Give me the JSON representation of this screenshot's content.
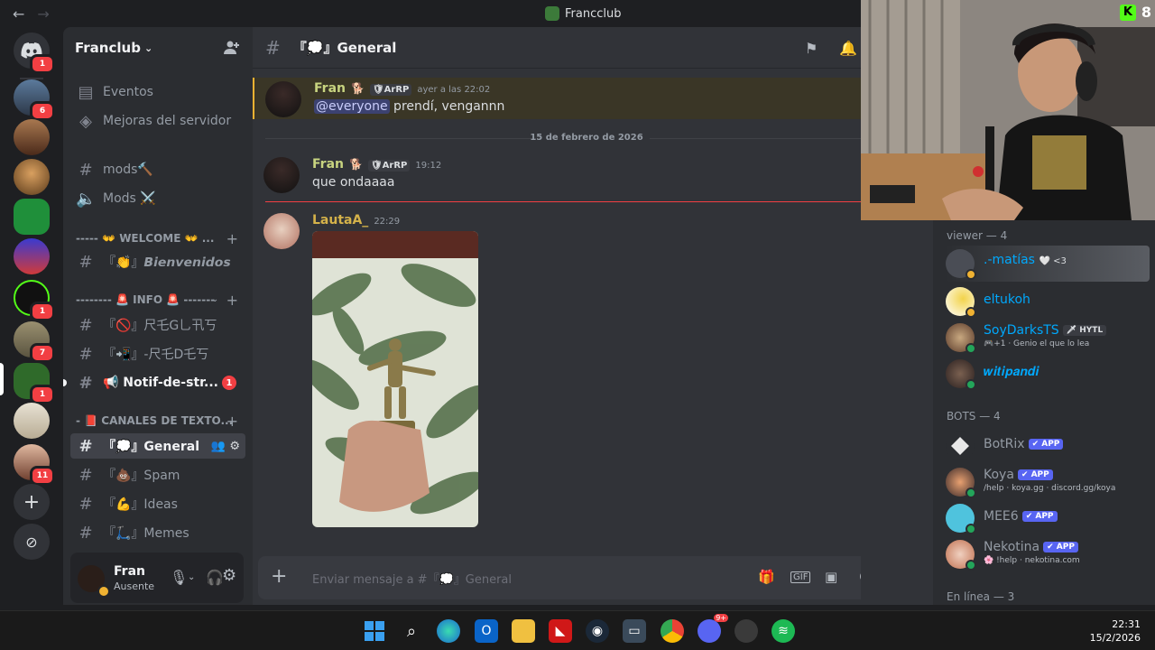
{
  "window": {
    "title": "Francclub",
    "back": "←",
    "forward": "→"
  },
  "rail": {
    "dm_badge": "1",
    "servers": [
      {
        "badge": "6"
      },
      {
        "badge": ""
      },
      {
        "badge": ""
      },
      {
        "badge": ""
      },
      {
        "badge": ""
      },
      {
        "badge": "1"
      },
      {
        "badge": "7"
      },
      {
        "badge": "1"
      },
      {
        "badge": ""
      },
      {
        "badge": "11"
      }
    ],
    "add": "+",
    "explore": "⊘"
  },
  "server": {
    "name": "Franclub",
    "chevron": "⌄"
  },
  "sidebar": {
    "events": "Eventos",
    "boosts": "Mejoras del servidor",
    "mods_channel": "mods🔨",
    "mods_voice": "Mods ⚔️",
    "cat_welcome": "----- 👐 WELCOME 👐 ...",
    "bienvenidos": "『👏』𝘽𝙞𝙚𝙣𝙫𝙚𝙣𝙞𝙙𝙤𝙨",
    "cat_info": "-------- 🚨 INFO 🚨 -------",
    "reglas": "『🚫』尺乇G乚卂丂",
    "redes": "『📲』-尺乇D乇丂",
    "notif": "📢 Notif-de-str...",
    "notif_badge": "1",
    "cat_text": "- 📕 CANALES DE TEXTO...",
    "general": "『💭』General",
    "spam": "『💩』Spam",
    "ideas": "『💪』Ideas",
    "memes": "『🛴』Memes"
  },
  "user": {
    "name": "Fran",
    "status": "Ausente"
  },
  "channel": {
    "name": "『💭』General",
    "hash": "#"
  },
  "messages": [
    {
      "author": "Fran",
      "badge": "🐕",
      "tag": "🛡ArRP",
      "time": "ayer a las 22:02",
      "mention": "@everyone",
      "text": " prendí, vengannn"
    },
    {
      "author": "Fran",
      "badge": "🐕",
      "tag": "🛡ArRP",
      "time": "19:12",
      "text": "que ondaaaa"
    },
    {
      "author": "LautaA_",
      "time": "22:29"
    }
  ],
  "date_divider": "15 de febrero de 2026",
  "composer": {
    "placeholder": "Enviar mensaje a #『💭』General",
    "plus": "+"
  },
  "members": {
    "viewer_header": "viewer — 4",
    "viewers": [
      {
        "name": ".-matías",
        "extra": "🤍 <3",
        "sub": ""
      },
      {
        "name": "eltukoh",
        "extra": "",
        "sub": ""
      },
      {
        "name": "SoyDarksTS",
        "extra": "🗡 HYTL",
        "sub": "🎮+1 · Genio el que lo lea"
      },
      {
        "name": "𝒘𝒊𝒕𝒊𝒑𝒂𝒏𝒅𝒊",
        "extra": "",
        "sub": ""
      }
    ],
    "bots_header": "BOTS — 4",
    "bots": [
      {
        "name": "BotRix",
        "app": "✔ APP",
        "sub": ""
      },
      {
        "name": "Koya",
        "app": "✔ APP",
        "sub": "/help · koya.gg · discord.gg/koya"
      },
      {
        "name": "MEE6",
        "app": "✔ APP",
        "sub": ""
      },
      {
        "name": "Nekotina",
        "app": "✔ APP",
        "sub": "🌸 !help · nekotina.com"
      }
    ],
    "online_header": "En línea — 3"
  },
  "webcam": {
    "overlay_number": "8",
    "overlay_logo": "K"
  },
  "taskbar": {
    "time": "22:31",
    "date": "15/2/2026",
    "discord_badge": "9+"
  }
}
